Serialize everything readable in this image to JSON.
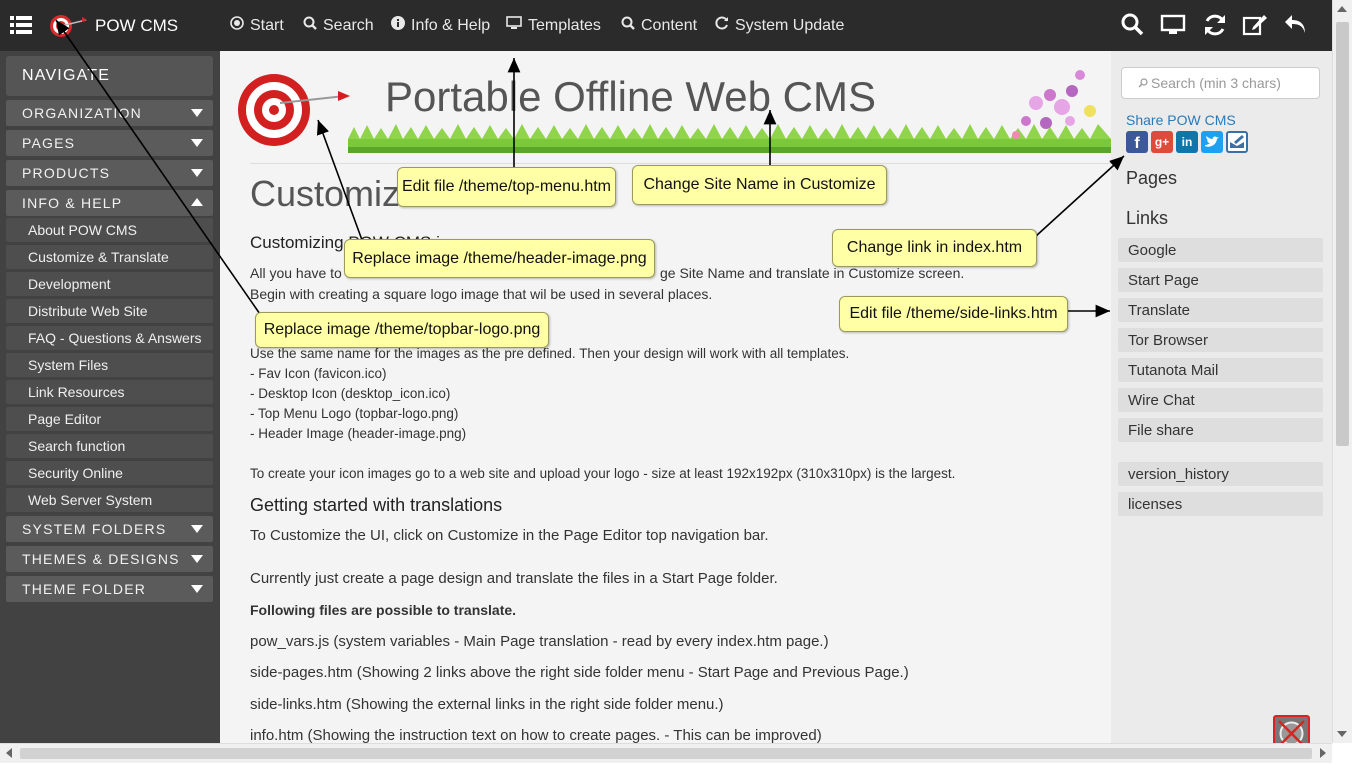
{
  "topbar": {
    "brand": "POW CMS",
    "menu": [
      {
        "label": "Start",
        "icon": "radio-target-icon"
      },
      {
        "label": "Search",
        "icon": "search-icon"
      },
      {
        "label": "Info & Help",
        "icon": "info-icon"
      },
      {
        "label": "Templates",
        "icon": "monitor-icon"
      },
      {
        "label": "Content",
        "icon": "search-icon"
      },
      {
        "label": "System Update",
        "icon": "refresh-icon"
      }
    ],
    "right_icons": [
      "search-icon",
      "monitor-icon",
      "refresh-icon",
      "edit-icon",
      "back-arrow-icon"
    ]
  },
  "sidebar": {
    "heading": "NAVIGATE",
    "sections_top": [
      "ORGANIZATION",
      "PAGES",
      "PRODUCTS"
    ],
    "open_section": "INFO & HELP",
    "items": [
      "About POW CMS",
      "Customize & Translate",
      "Development",
      "Distribute Web Site",
      "FAQ - Questions & Answers",
      "System Files",
      "Link Resources",
      "Page Editor",
      "Search function",
      "Security Online",
      "Web Server System"
    ],
    "sections_bottom": [
      "SYSTEM FOLDERS",
      "THEMES & DESIGNS",
      "THEME FOLDER"
    ]
  },
  "header": {
    "site_name": "Portable Offline Web CMS"
  },
  "content": {
    "title": "Customiz",
    "subtitle": "Customizing POW CMS i",
    "p1": "All you have to ... Change Site Name and translate in Customize screen.",
    "p1a": "All you have to",
    "p1b": "ge Site Name and translate in Customize screen.",
    "p2": "Begin with creating a square logo image that wil be used in several places.",
    "p3": "Use the same name for the images as the pre defined. Then your design will work with all templates.",
    "list": [
      "- Fav Icon (favicon.ico)",
      "- Desktop Icon (desktop_icon.ico)",
      "- Top Menu Logo (topbar-logo.png)",
      "- Header Image (header-image.png)"
    ],
    "p4": "To create your icon images go to a web site and upload your logo - size at least 192x192px (310x310px) is the largest.",
    "h_translations": "Getting started with translations",
    "p5": "To Customize the UI, click on Customize in the Page Editor top navigation bar.",
    "p6": "Currently just create a page design and translate the files in a Start Page folder.",
    "bold": "Following files are possible to translate.",
    "files": [
      "pow_vars.js (system variables - Main Page translation - read by every index.htm page.)",
      "side-pages.htm (Showing 2 links above the right side folder menu - Start Page and Previous Page.)",
      "side-links.htm (Showing the external links in the right side folder menu.)",
      "info.htm (Showing the instruction text on how to create pages. - This can be improved)"
    ]
  },
  "right": {
    "search_placeholder": "Search (min 3 chars)",
    "share_label": "Share POW CMS",
    "share_icons": [
      "facebook-icon",
      "google-plus-icon",
      "linkedin-icon",
      "twitter-icon",
      "email-icon"
    ],
    "pages_heading": "Pages",
    "links_heading": "Links",
    "links": [
      "Google",
      "Start Page",
      "Translate",
      "Tor Browser",
      "Tutanota Mail",
      "Wire Chat",
      "File share"
    ],
    "extra": [
      "version_history",
      "licenses"
    ]
  },
  "annotations": {
    "top_menu": "Edit file /theme/top-menu.htm",
    "site_name": "Change Site Name in Customize",
    "header_image": "Replace image /theme/header-image.png",
    "index_link": "Change link in index.htm",
    "topbar_logo": "Replace image /theme/topbar-logo.png",
    "side_links": "Edit file  /theme/side-links.htm"
  },
  "colors": {
    "topbar": "#2b2b2b",
    "sidebar": "#424242",
    "note": "#ffffa6",
    "link": "#2a7ab8",
    "logo_red": "#d92b2b"
  }
}
